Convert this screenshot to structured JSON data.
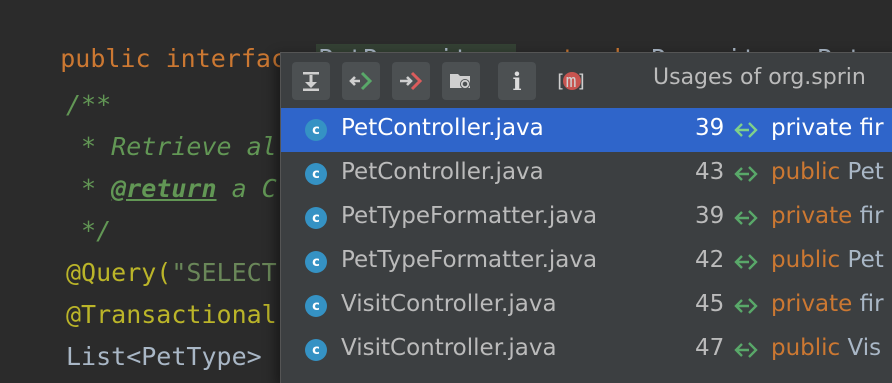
{
  "editor": {
    "line1": {
      "kw1": "public",
      "kw2": "interface",
      "name": "PetRepository",
      "kw3": "extends",
      "rest": "Repository<Pet, I"
    },
    "line2": {
      "text": "/**"
    },
    "line3": {
      "text": " * Retrieve al"
    },
    "line4": {
      "star": " * ",
      "tag": "@return",
      "rest": " a C"
    },
    "line5": {
      "text": " */"
    },
    "line6": {
      "annot": "@Query(",
      "str": "\"SELECT"
    },
    "line7": {
      "annot": "@Transactional"
    },
    "line8": {
      "text": "List<PetType> "
    }
  },
  "popup": {
    "title": "Usages of org.sprin",
    "toolbar": [
      {
        "name": "download-icon"
      },
      {
        "name": "usage-in-icon"
      },
      {
        "name": "usage-out-icon"
      },
      {
        "name": "folder-settings-icon"
      },
      {
        "name": "info-icon",
        "label": "i"
      },
      {
        "name": "module-icon",
        "label": "[m]"
      }
    ],
    "rows": [
      {
        "file": "PetController.java",
        "line": "39",
        "kw": "private",
        "rest": " fir",
        "selected": true
      },
      {
        "file": "PetController.java",
        "line": "43",
        "kw": "public",
        "rest": " Pet"
      },
      {
        "file": "PetTypeFormatter.java",
        "line": "39",
        "kw": "private",
        "rest": " fir"
      },
      {
        "file": "PetTypeFormatter.java",
        "line": "42",
        "kw": "public",
        "rest": " Pet"
      },
      {
        "file": "VisitController.java",
        "line": "45",
        "kw": "private",
        "rest": " fir"
      },
      {
        "file": "VisitController.java",
        "line": "47",
        "kw": "public",
        "rest": " Vis"
      }
    ]
  },
  "colors": {
    "accent": "#2f65ca",
    "editor_bg": "#2b2b2b",
    "popup_bg": "#3c3f41",
    "keyword": "#cc7832",
    "javadoc": "#629755"
  }
}
